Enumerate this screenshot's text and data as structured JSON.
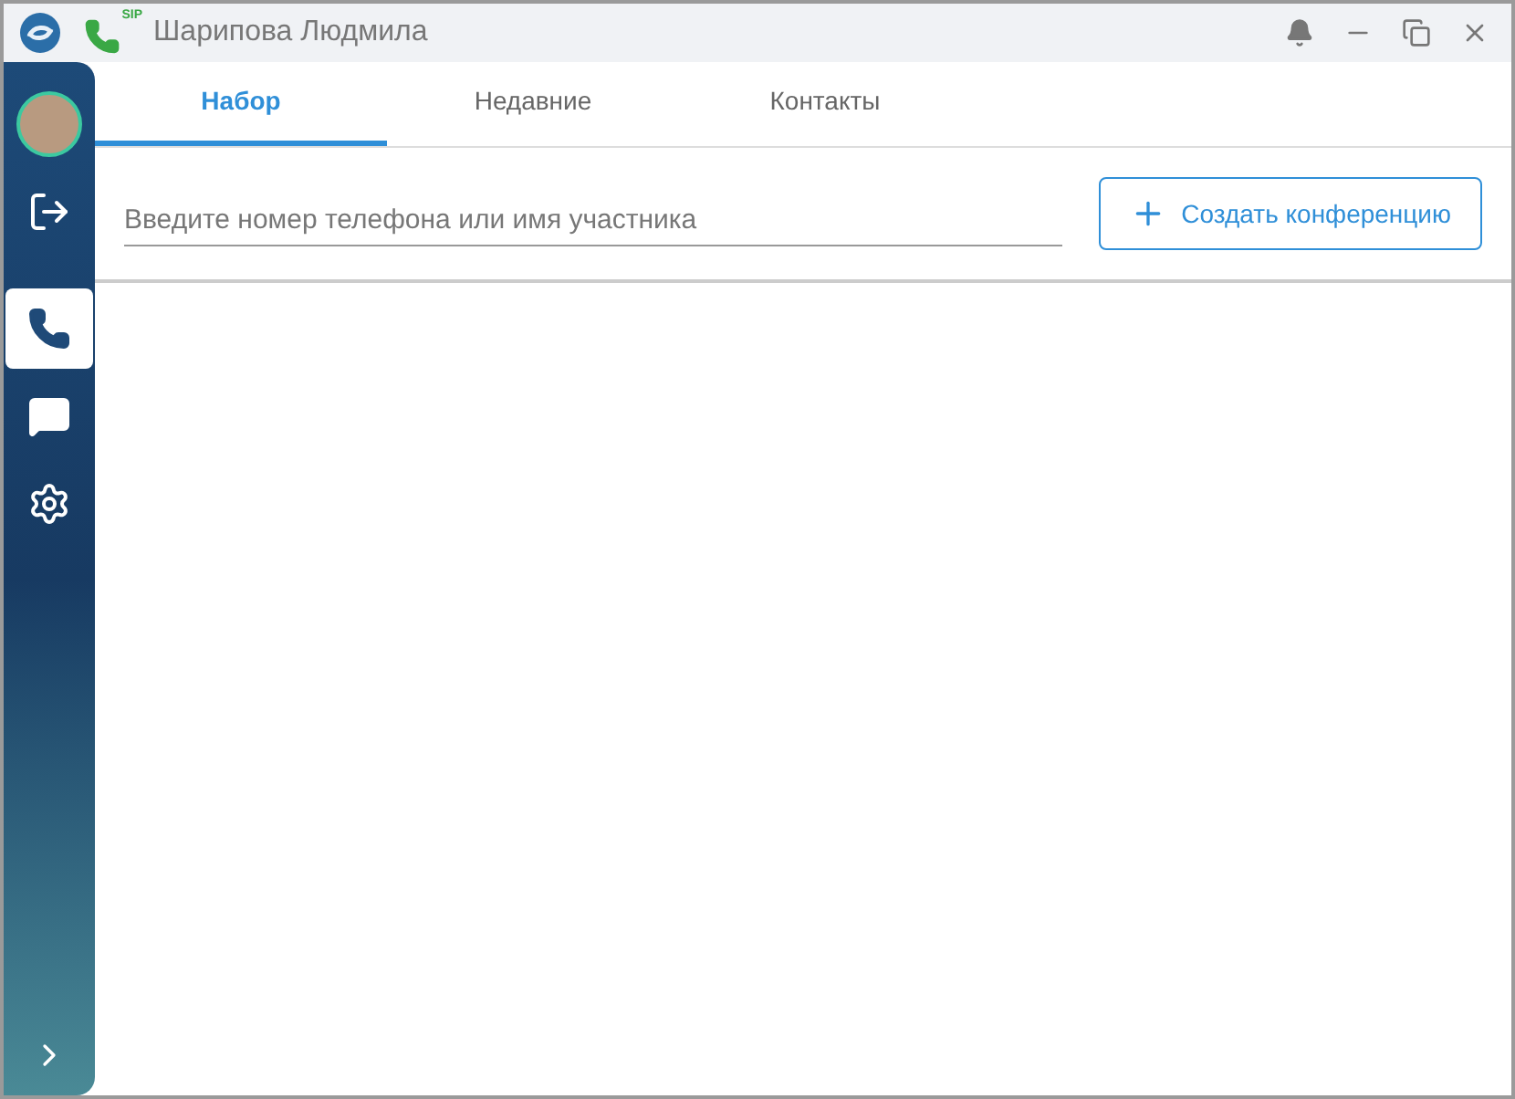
{
  "window": {
    "title": "Шарипова Людмила",
    "sip_badge": "SIP"
  },
  "sidebar": {
    "items": [
      {
        "kind": "logout",
        "selected": false
      },
      {
        "kind": "phone",
        "selected": true
      },
      {
        "kind": "chat",
        "selected": false
      },
      {
        "kind": "settings",
        "selected": false
      }
    ]
  },
  "tabs": [
    {
      "label": "Набор",
      "selected": true
    },
    {
      "label": "Недавние",
      "selected": false
    },
    {
      "label": "Контакты",
      "selected": false
    }
  ],
  "search": {
    "placeholder": "Введите номер телефона или имя участника"
  },
  "conference_button": {
    "label": "Создать конференцию"
  }
}
